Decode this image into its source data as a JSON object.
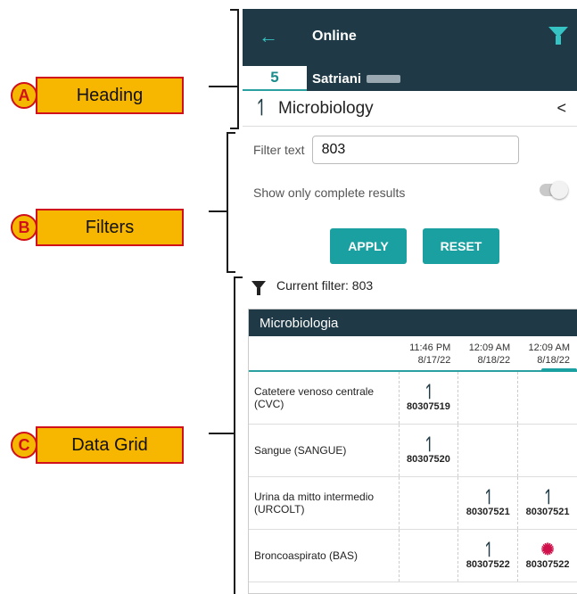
{
  "callouts": [
    {
      "letter": "A",
      "label": "Heading"
    },
    {
      "letter": "B",
      "label": "Filters"
    },
    {
      "letter": "C",
      "label": "Data Grid"
    }
  ],
  "topbar": {
    "back_icon": "arrow-left-icon",
    "status": "Online",
    "filter_icon": "funnel-icon"
  },
  "patient": {
    "bed": "5",
    "name": "Satriani"
  },
  "module": {
    "icon": "microscope-icon",
    "title": "Microbiology",
    "share_icon": "share-icon"
  },
  "filters": {
    "text_label": "Filter text",
    "text_value": "803",
    "complete_label": "Show only complete results",
    "apply_label": "APPLY",
    "reset_label": "RESET"
  },
  "current_filter": "Current filter: 803",
  "grid": {
    "title": "Microbiologia",
    "columns": [
      {
        "time": "11:46 PM",
        "date": "8/17/22"
      },
      {
        "time": "12:09 AM",
        "date": "8/18/22"
      },
      {
        "time": "12:09 AM",
        "date": "8/18/22"
      }
    ],
    "rows": [
      {
        "label": "Catetere venoso centrale (CVC)",
        "cells": [
          "80307519",
          "",
          ""
        ]
      },
      {
        "label": "Sangue (SANGUE)",
        "cells": [
          "80307520",
          "",
          ""
        ]
      },
      {
        "label": "Urina da mitto intermedio (URCOLT)",
        "cells": [
          "",
          "80307521",
          "80307521"
        ]
      },
      {
        "label": "Broncoaspirato (BAS)",
        "cells": [
          "",
          "80307522",
          "80307522"
        ]
      }
    ]
  },
  "colors": {
    "primary_dark": "#1f3a46",
    "accent_teal": "#1aa0a0",
    "callout_fill": "#f7b600",
    "callout_border": "#d0101a",
    "alert_red": "#d0104a"
  }
}
